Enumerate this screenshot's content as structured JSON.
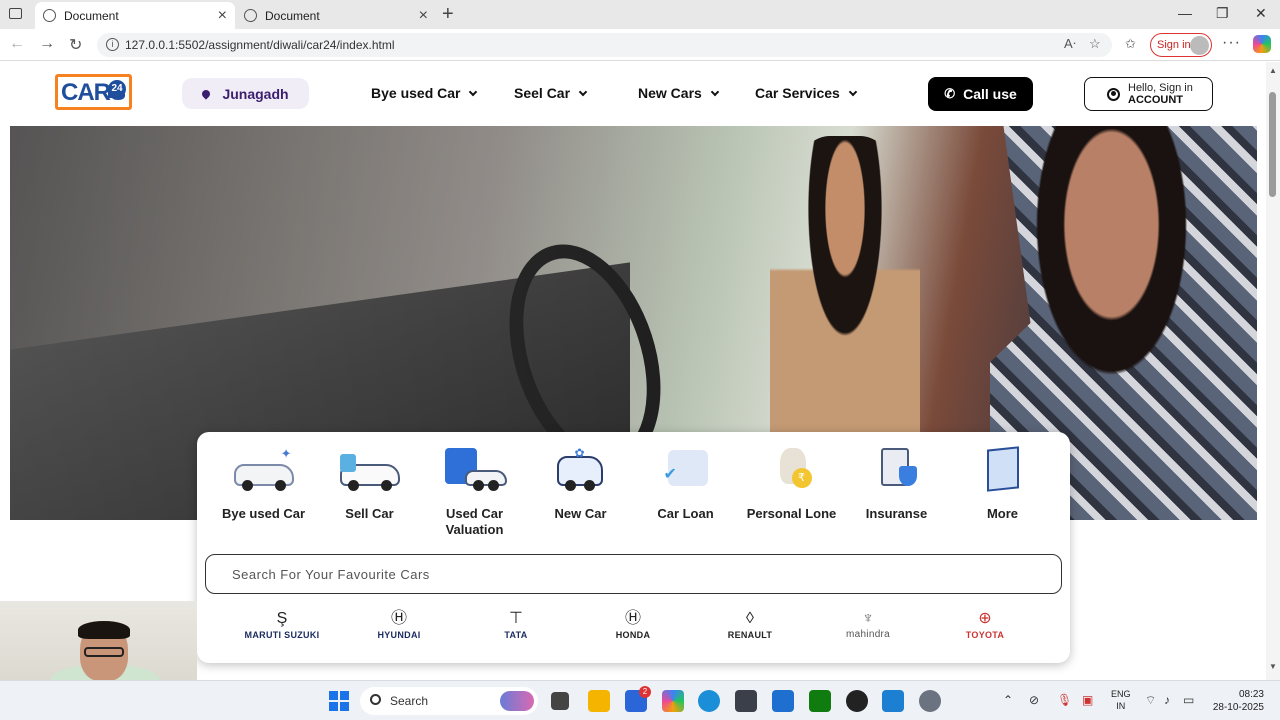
{
  "browser": {
    "tabs": [
      {
        "label": "Document"
      },
      {
        "label": "Document"
      }
    ],
    "url": "127.0.0.1:5502/assignment/diwali/car24/index.html",
    "signin_label": "Sign in"
  },
  "header": {
    "logo_text": "CARS",
    "logo_number": "24",
    "location": "Junagadh",
    "nav": [
      {
        "label": "Bye used Car"
      },
      {
        "label": "Seel Car"
      },
      {
        "label": "New Cars"
      },
      {
        "label": "Car Services"
      }
    ],
    "call_label": "Call use",
    "account_line1": "Hello, Sign in",
    "account_line2": "ACCOUNT"
  },
  "services": [
    {
      "label": "Bye used Car",
      "icon": "used-car-icon"
    },
    {
      "label": "Sell Car",
      "icon": "sell-car-icon"
    },
    {
      "label": "Used Car Valuation",
      "icon": "calculator-car-icon"
    },
    {
      "label": "New Car",
      "icon": "new-car-icon"
    },
    {
      "label": "Car Loan",
      "icon": "car-loan-icon"
    },
    {
      "label": "Personal Lone",
      "icon": "money-bag-icon"
    },
    {
      "label": "Insuranse",
      "icon": "insurance-shield-icon"
    },
    {
      "label": "More",
      "icon": "grid-more-icon"
    }
  ],
  "search": {
    "placeholder": "Search For Your Favourite Cars",
    "value": ""
  },
  "brands": [
    {
      "name": "MARUTI SUZUKI",
      "glyph": "Ş"
    },
    {
      "name": "HYUNDAI",
      "glyph": "Ⓗ"
    },
    {
      "name": "TATA",
      "glyph": "⊤"
    },
    {
      "name": "HONDA",
      "glyph": "Ⓗ"
    },
    {
      "name": "RENAULT",
      "glyph": "◊"
    },
    {
      "name": "mahindra",
      "glyph": "♆"
    },
    {
      "name": "TOYOTA",
      "glyph": "⊕"
    }
  ],
  "taskbar": {
    "search_label": "Search",
    "lang_line1": "ENG",
    "lang_line2": "IN",
    "time": "08:23",
    "date": "28-10-2025",
    "badge_count": "2"
  },
  "colors": {
    "brand_orange": "#f5821f",
    "brand_blue": "#1f4e9c",
    "location_bg": "#f1edf6"
  }
}
